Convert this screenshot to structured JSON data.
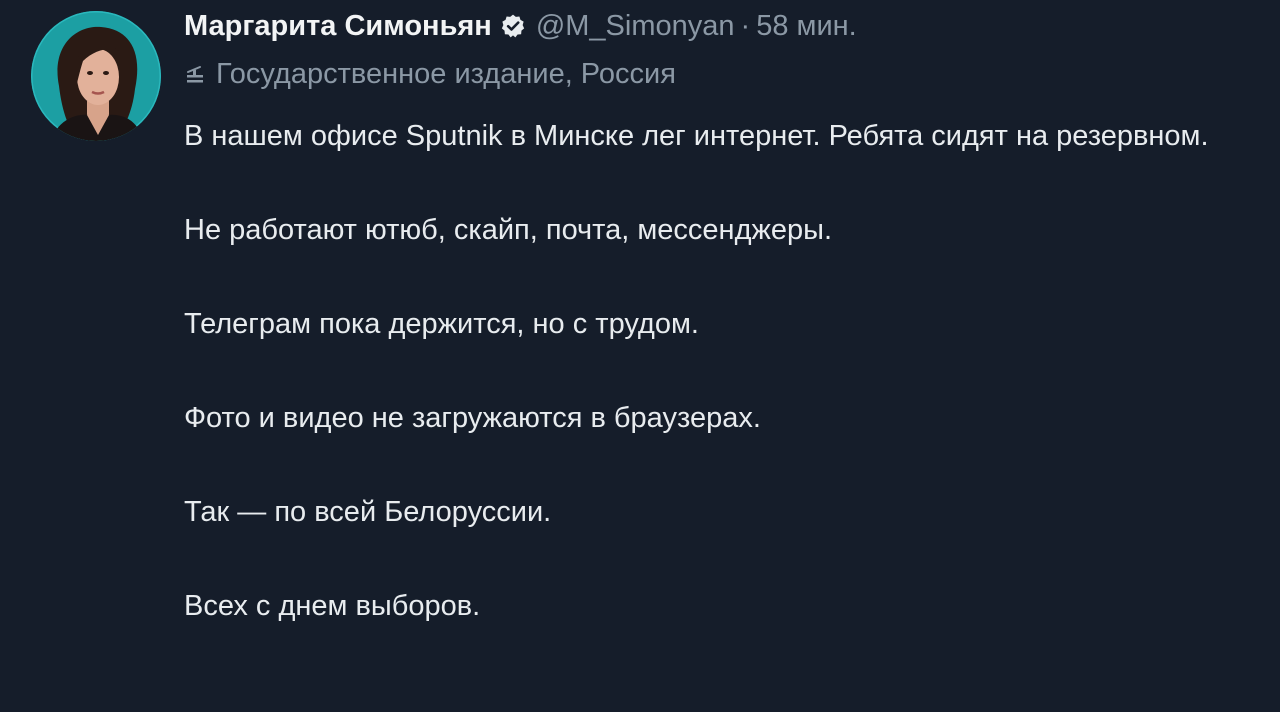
{
  "author": {
    "display_name": "Маргарита Симоньян",
    "handle": "@M_Simonyan",
    "separator": "·",
    "time": "58 мин.",
    "verified_icon": "verified-badge-icon",
    "avatar": "avatar-photo"
  },
  "account_label": {
    "icon": "state-media-icon",
    "text": "Государственное издание, Россия"
  },
  "tweet": {
    "paragraphs": [
      "В нашем офисе Sputnik в Минске лег интернет. Ребята сидят на резервном.",
      "Не работают ютюб, скайп, почта, мессенджеры.",
      "Телеграм пока держится, но с трудом.",
      "Фото и видео не загружаются в браузерах.",
      "Так — по всей Белоруссии.",
      "Всех с днем выборов."
    ]
  },
  "colors": {
    "background": "#151d2a",
    "primary_text": "#e8ecef",
    "secondary_text": "#8b98a5",
    "verified_badge": "#e8ecef",
    "avatar_ring": "#1fa3a8"
  }
}
